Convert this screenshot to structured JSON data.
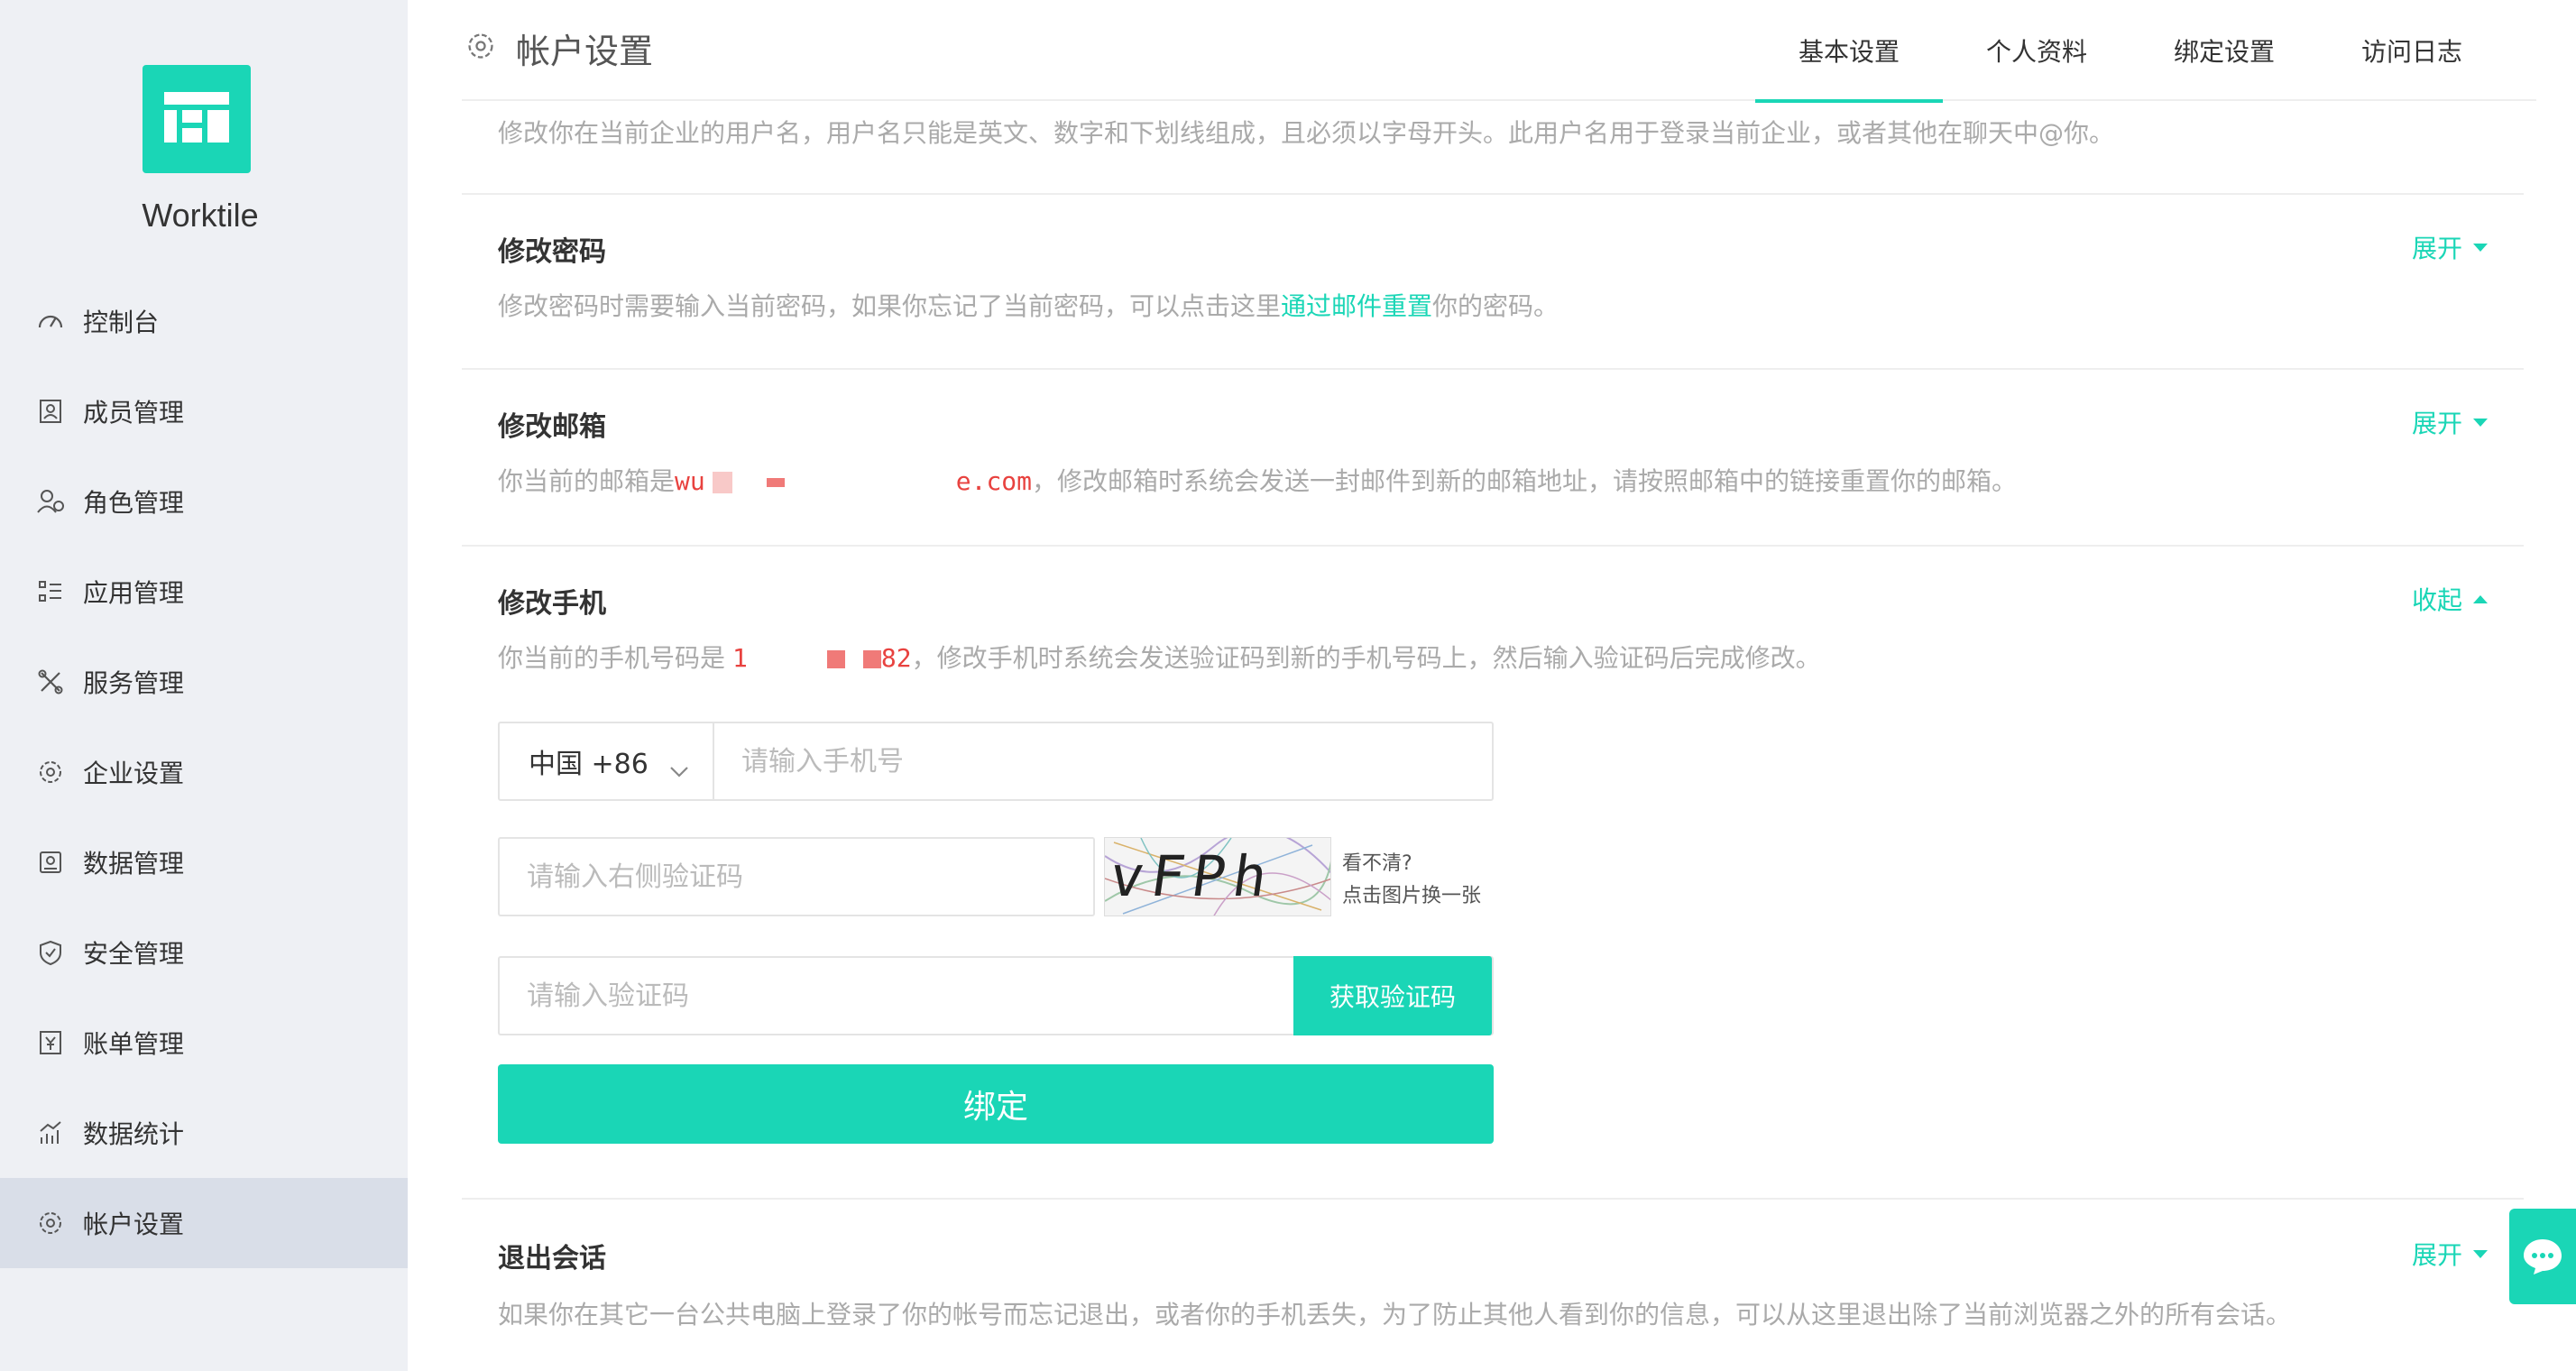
{
  "brand": {
    "name": "Worktile",
    "accent": "#1ad6b6"
  },
  "sidebar": {
    "items": [
      {
        "label": "控制台",
        "icon": "dashboard-icon"
      },
      {
        "label": "成员管理",
        "icon": "member-card-icon"
      },
      {
        "label": "角色管理",
        "icon": "roles-icon"
      },
      {
        "label": "应用管理",
        "icon": "apps-list-icon"
      },
      {
        "label": "服务管理",
        "icon": "tools-icon"
      },
      {
        "label": "企业设置",
        "icon": "gear-icon"
      },
      {
        "label": "数据管理",
        "icon": "database-icon"
      },
      {
        "label": "安全管理",
        "icon": "shield-icon"
      },
      {
        "label": "账单管理",
        "icon": "bill-icon"
      },
      {
        "label": "数据统计",
        "icon": "stats-icon"
      },
      {
        "label": "帐户设置",
        "icon": "gear-icon",
        "active": true
      }
    ]
  },
  "header": {
    "title": "帐户设置",
    "tabs": [
      "基本设置",
      "个人资料",
      "绑定设置",
      "访问日志"
    ],
    "active_tab": "基本设置"
  },
  "username_section": {
    "desc": "修改你在当前企业的用户名，用户名只能是英文、数字和下划线组成，且必须以字母开头。此用户名用于登录当前企业，或者其他在聊天中@你。"
  },
  "password_section": {
    "title": "修改密码",
    "desc_before": "修改密码时需要输入当前密码，如果你忘记了当前密码，可以点击这里",
    "link": "通过邮件重置",
    "desc_after": "你的密码。",
    "toggle": "展开"
  },
  "email_section": {
    "title": "修改邮箱",
    "desc_before": "你当前的邮箱是",
    "email_start": "wu",
    "email_end": "e.com",
    "desc_after": "，修改邮箱时系统会发送一封邮件到新的邮箱地址，请按照邮箱中的链接重置你的邮箱。",
    "toggle": "展开"
  },
  "phone_section": {
    "title": "修改手机",
    "desc_before": "你当前的手机号码是",
    "phone_start": "1",
    "phone_end": "82",
    "desc_after": "，修改手机时系统会发送验证码到新的手机号码上，然后输入验证码后完成修改。",
    "toggle": "收起",
    "country": "中国 +86",
    "phone_placeholder": "请输入手机号",
    "captcha_placeholder": "请输入右侧验证码",
    "captcha_text": "vFPh",
    "captcha_hint_line1": "看不清?",
    "captcha_hint_line2": "点击图片换一张",
    "code_placeholder": "请输入验证码",
    "get_code_label": "获取验证码",
    "bind_label": "绑定"
  },
  "logout_section": {
    "title": "退出会话",
    "desc": "如果你在其它一台公共电脑上登录了你的帐号而忘记退出，或者你的手机丢失，为了防止其他人看到你的信息，可以从这里退出除了当前浏览器之外的所有会话。",
    "toggle": "展开"
  }
}
